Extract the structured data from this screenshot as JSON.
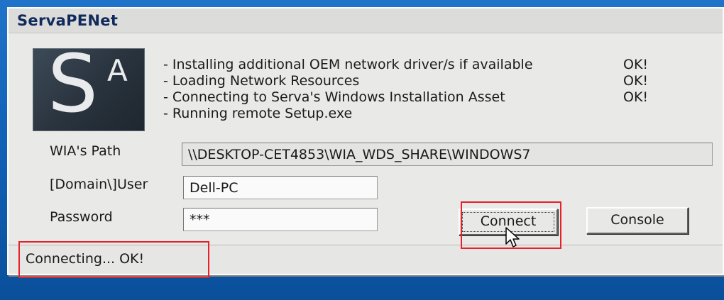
{
  "window": {
    "title": "ServaPENet"
  },
  "logo": {
    "letter_main": "S",
    "letter_super": "A"
  },
  "status_lines": [
    {
      "text": "- Installing additional OEM network driver/s if available",
      "result": "OK!"
    },
    {
      "text": "- Loading Network Resources",
      "result": "OK!"
    },
    {
      "text": "- Connecting to Serva's Windows Installation Asset",
      "result": "OK!"
    },
    {
      "text": "- Running remote Setup.exe",
      "result": ""
    }
  ],
  "form": {
    "wia_path_label": "WIA's Path",
    "wia_path_value": "\\\\DESKTOP-CET4853\\WIA_WDS_SHARE\\WINDOWS7",
    "user_label": "[Domain\\]User",
    "user_value": "Dell-PC",
    "password_label": "Password",
    "password_value": "***"
  },
  "buttons": {
    "connect": "Connect",
    "console": "Console"
  },
  "statusbar": {
    "text": "Connecting... OK!"
  },
  "colors": {
    "annotation_highlight": "#e8202a",
    "desktop_background": "#0f5fb4"
  }
}
